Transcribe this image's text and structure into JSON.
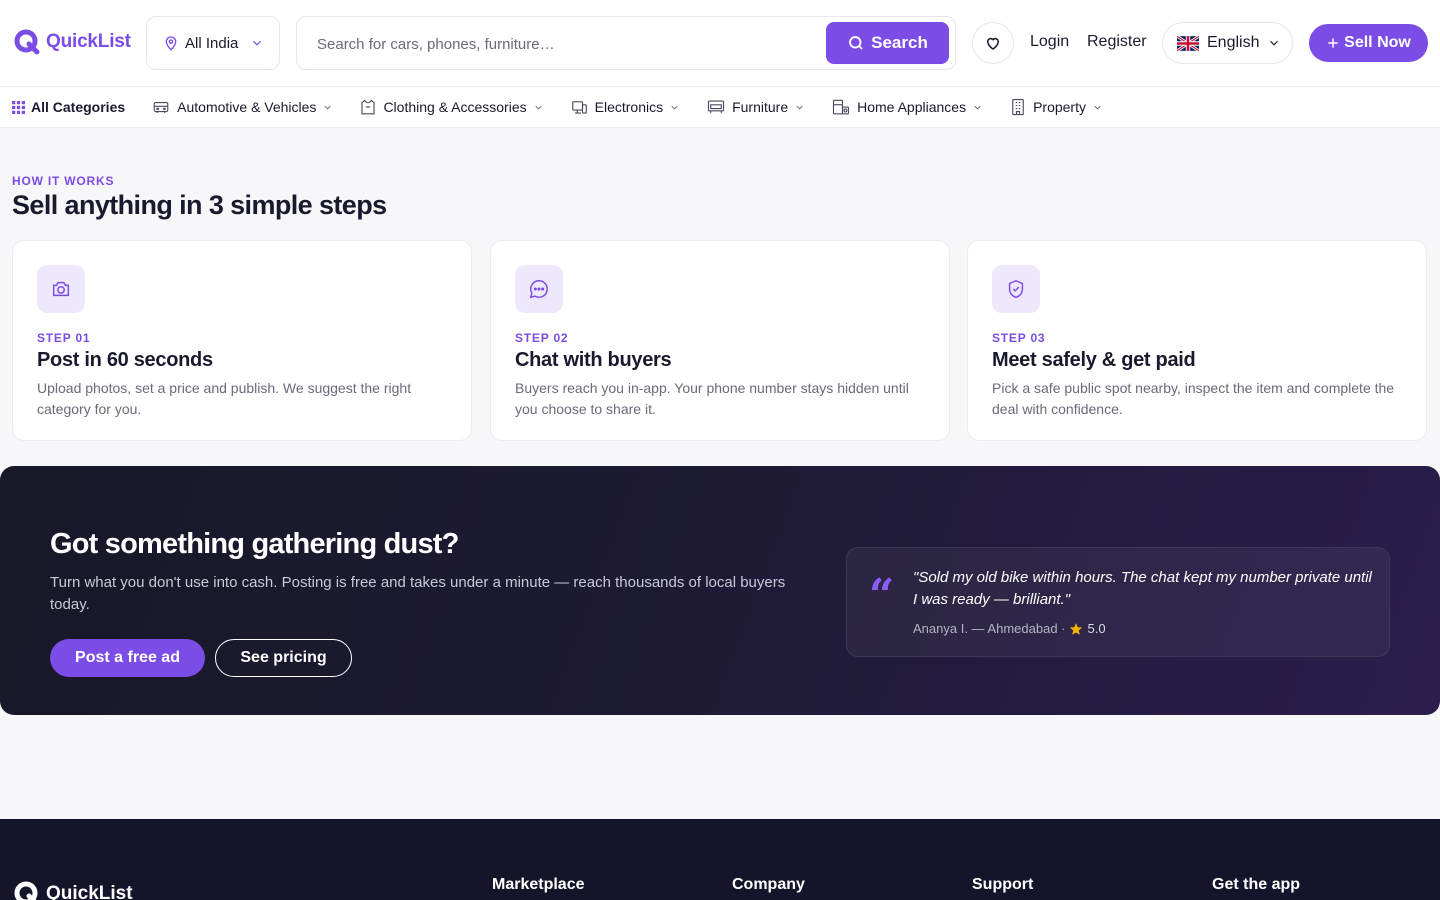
{
  "brand": {
    "name": "QuickList",
    "accent": "#7b4ce6"
  },
  "header": {
    "location": "All India",
    "search_placeholder": "Search for cars, phones, furniture…",
    "search_button": "Search",
    "login": "Login",
    "register": "Register",
    "language": "English",
    "sell_button": "Sell Now"
  },
  "categories": [
    {
      "label": "All Categories",
      "icon": "grid-icon"
    },
    {
      "label": "Automotive & Vehicles",
      "icon": "car-icon"
    },
    {
      "label": "Clothing & Accessories",
      "icon": "shirt-icon"
    },
    {
      "label": "Electronics",
      "icon": "device-icon"
    },
    {
      "label": "Furniture",
      "icon": "sofa-icon"
    },
    {
      "label": "Home Appliances",
      "icon": "appliance-icon"
    },
    {
      "label": "Property",
      "icon": "building-icon"
    }
  ],
  "how_it_works": {
    "eyebrow": "HOW IT WORKS",
    "title": "Sell anything in 3 simple steps",
    "steps": [
      {
        "label": "STEP 01",
        "title": "Post in 60 seconds",
        "desc": "Upload photos, set a price and publish. We suggest the right category for you.",
        "icon": "camera-icon"
      },
      {
        "label": "STEP 02",
        "title": "Chat with buyers",
        "desc": "Buyers reach you in-app. Your phone number stays hidden until you choose to share it.",
        "icon": "chat-icon"
      },
      {
        "label": "STEP 03",
        "title": "Meet safely & get paid",
        "desc": "Pick a safe public spot nearby, inspect the item and complete the deal with confidence.",
        "icon": "shield-check-icon"
      }
    ]
  },
  "cta": {
    "title": "Got something gathering dust?",
    "desc": "Turn what you don't use into cash. Posting is free and takes under a minute — reach thousands of local buyers today.",
    "primary": "Post a free ad",
    "secondary": "See pricing",
    "quote_mark": "“",
    "quote": "\"Sold my old bike within hours. The chat kept my number private until I was ready — brilliant.\"",
    "author": "Ananya I. — Ahmedabad ·",
    "rating": "5.0"
  },
  "footer": {
    "brand": "QuickList",
    "columns": [
      "Marketplace",
      "Company",
      "Support",
      "Get the app"
    ]
  }
}
